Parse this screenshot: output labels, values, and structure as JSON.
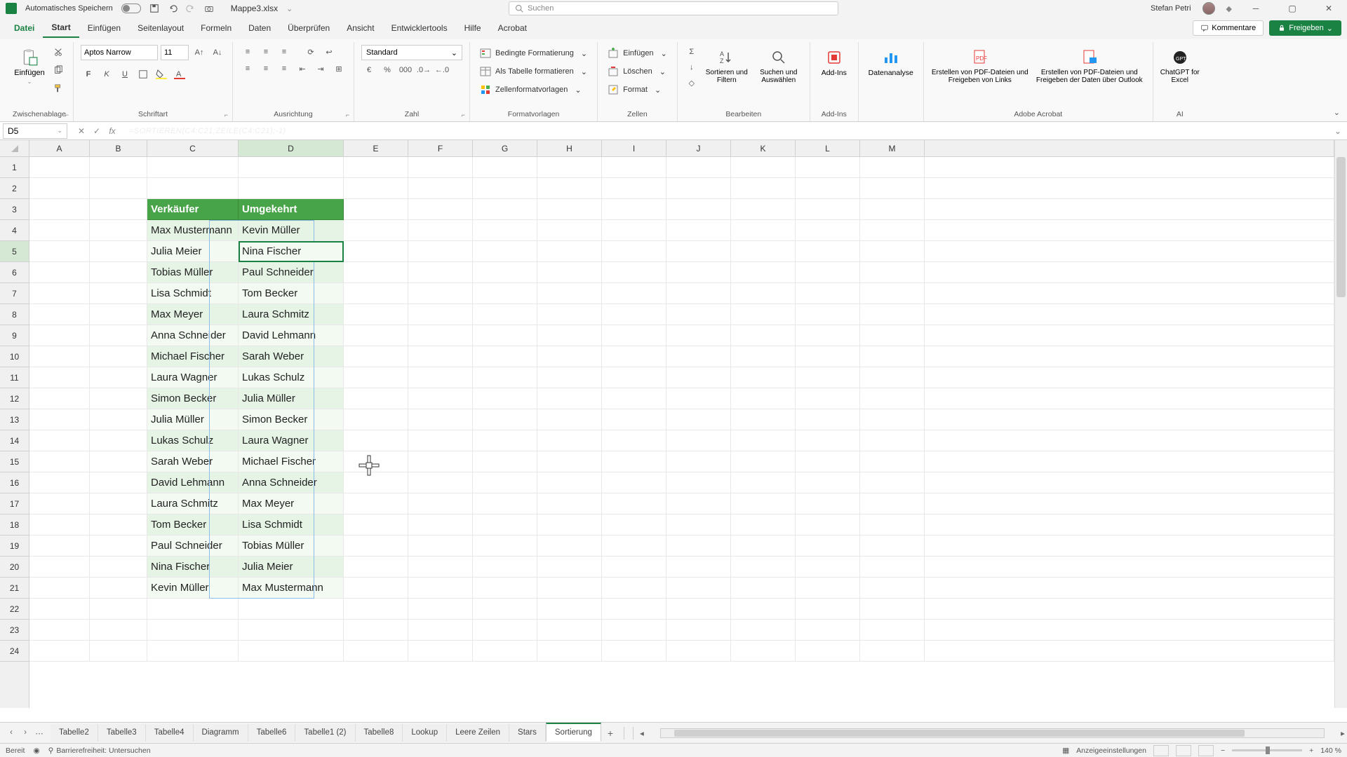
{
  "titlebar": {
    "autosave": "Automatisches Speichern",
    "doc_name": "Mappe3.xlsx",
    "search_placeholder": "Suchen",
    "user": "Stefan Petri"
  },
  "tabs": {
    "file": "Datei",
    "items": [
      "Start",
      "Einfügen",
      "Seitenlayout",
      "Formeln",
      "Daten",
      "Überprüfen",
      "Ansicht",
      "Entwicklertools",
      "Hilfe",
      "Acrobat"
    ],
    "active": "Start",
    "comments": "Kommentare",
    "share": "Freigeben"
  },
  "ribbon": {
    "clipboard": {
      "paste": "Einfügen",
      "label": "Zwischenablage"
    },
    "font": {
      "name": "Aptos Narrow",
      "size": "11",
      "label": "Schriftart"
    },
    "align": {
      "label": "Ausrichtung"
    },
    "number": {
      "format": "Standard",
      "label": "Zahl"
    },
    "styles": {
      "cond": "Bedingte Formatierung",
      "table": "Als Tabelle formatieren",
      "cell": "Zellenformatvorlagen",
      "label": "Formatvorlagen"
    },
    "cells": {
      "insert": "Einfügen",
      "delete": "Löschen",
      "format": "Format",
      "label": "Zellen"
    },
    "editing": {
      "sort": "Sortieren und Filtern",
      "find": "Suchen und Auswählen",
      "label": "Bearbeiten"
    },
    "addins": {
      "btn": "Add-Ins",
      "label": "Add-Ins"
    },
    "analysis": {
      "btn": "Datenanalyse"
    },
    "acrobat": {
      "pdf1": "Erstellen von PDF-Dateien und Freigeben von Links",
      "pdf2": "Erstellen von PDF-Dateien und Freigeben der Daten über Outlook",
      "label": "Adobe Acrobat"
    },
    "ai": {
      "btn": "ChatGPT for Excel",
      "label": "AI"
    }
  },
  "formula": {
    "cell_ref": "D5",
    "formula_ghost": "=SORTIEREN(C4:C21;ZEILE(C4:C21);-1)"
  },
  "columns": [
    "A",
    "B",
    "C",
    "D",
    "E",
    "F",
    "G",
    "H",
    "I",
    "J",
    "K",
    "L",
    "M"
  ],
  "header_row": 3,
  "headers": {
    "c": "Verkäufer",
    "d": "Umgekehrt"
  },
  "data_start_row": 4,
  "active_cell": "D5",
  "col_c": [
    "Max Mustermann",
    "Julia Meier",
    "Tobias Müller",
    "Lisa Schmidt",
    "Max Meyer",
    "Anna Schneider",
    "Michael Fischer",
    "Laura Wagner",
    "Simon Becker",
    "Julia Müller",
    "Lukas Schulz",
    "Sarah Weber",
    "David Lehmann",
    "Laura Schmitz",
    "Tom Becker",
    "Paul Schneider",
    "Nina Fischer",
    "Kevin Müller"
  ],
  "col_d": [
    "Kevin Müller",
    "Nina Fischer",
    "Paul Schneider",
    "Tom Becker",
    "Laura Schmitz",
    "David Lehmann",
    "Sarah Weber",
    "Lukas Schulz",
    "Julia Müller",
    "Simon Becker",
    "Laura Wagner",
    "Michael Fischer",
    "Anna Schneider",
    "Max Meyer",
    "Lisa Schmidt",
    "Tobias Müller",
    "Julia Meier",
    "Max Mustermann"
  ],
  "sheets": {
    "items": [
      "Tabelle2",
      "Tabelle3",
      "Tabelle4",
      "Diagramm",
      "Tabelle6",
      "Tabelle1 (2)",
      "Tabelle8",
      "Lookup",
      "Leere Zeilen",
      "Stars",
      "Sortierung"
    ],
    "active": "Sortierung"
  },
  "status": {
    "ready": "Bereit",
    "access": "Barrierefreiheit: Untersuchen",
    "display": "Anzeigeeinstellungen",
    "zoom": "140 %"
  }
}
